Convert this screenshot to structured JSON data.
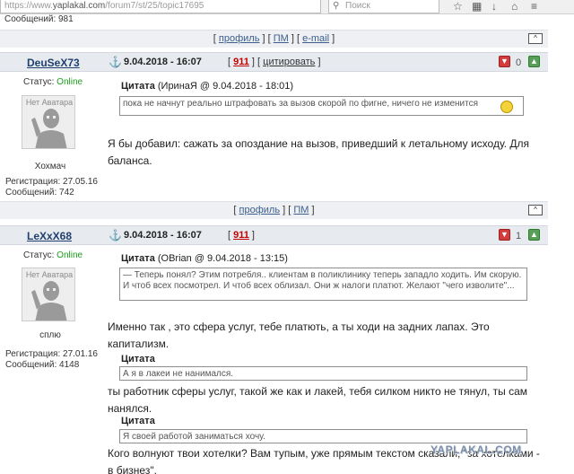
{
  "browser": {
    "url_prefix": "https://www.",
    "url_domain": "yaplakal.com",
    "url_path": "/forum7/st/25/topic17695",
    "search_placeholder": "Поиск",
    "icons": [
      "search-icon",
      "star-icon",
      "bookmark-icon",
      "download-icon",
      "home-icon"
    ]
  },
  "top_cutoff": "Сообщений: 981",
  "links": {
    "profile": "профиль",
    "pm": "ПМ",
    "email": "e-mail",
    "up": "^"
  },
  "posts": [
    {
      "username": "DeuSeX73",
      "date": "9.04.2018 - 16:07",
      "num": "911",
      "quote_action": "цитировать",
      "votes": "0",
      "status_label": "Статус:",
      "status_value": "Online",
      "avatar_text": "Нет Аватара",
      "user_title": "Хохмач",
      "reg_label": "Регистрация:",
      "reg_date": "27.05.16",
      "msgs_label": "Сообщений:",
      "msgs_count": "742",
      "quote_label": "Цитата",
      "quote_meta": "(ИринаЯ @ 9.04.2018 - 18:01)",
      "quote_text": "пока не начнут реально штрафовать за вызов скорой по фигне, ничего не изменится",
      "text": "Я бы добавил: сажать за опоздание на вызов, приведший к летальному исходу. Для баланса."
    },
    {
      "username": "LeXxX68",
      "date": "9.04.2018 - 16:07",
      "num": "911",
      "votes": "1",
      "status_label": "Статус:",
      "status_value": "Online",
      "avatar_text": "Нет Аватара",
      "user_title": "сплю",
      "reg_label": "Регистрация:",
      "reg_date": "27.01.16",
      "msgs_label": "Сообщений:",
      "msgs_count": "4148",
      "quote1_label": "Цитата",
      "quote1_meta": "(OBrian @ 9.04.2018 - 13:15)",
      "quote1_text": "— Теперь понял? Этим потребля.. клиентам в поликлинику теперь западло ходить. Им скорую. И чтоб всех посмотрел. И чтоб всех облизал. Они ж налоги платют. Желают \"чего изволите\"...",
      "text1": "Именно так , это сфера услуг, тебе платють, а ты ходи на задних лапах. Это капитализм.",
      "quote2_label": "Цитата",
      "quote2_text": "А я в лакеи не нанимался.",
      "text2": "ты работник сферы услуг, такой же как и лакей, тебя силком никто не тянул, ты сам нанялся.",
      "quote3_label": "Цитата",
      "quote3_text": "Я своей работой заниматься хочу.",
      "text3": "Кого волнуют твои хотелки? Вам тупым, уже прямым текстом сказали, \"за хотелками - в бизнез\"."
    }
  ],
  "watermark": "YAPLAKAL.COM",
  "colors": {
    "header_bg": "#e7ebf0",
    "link": "#1f3f6e",
    "online": "#1aa01a",
    "red_num": "#c30000"
  }
}
